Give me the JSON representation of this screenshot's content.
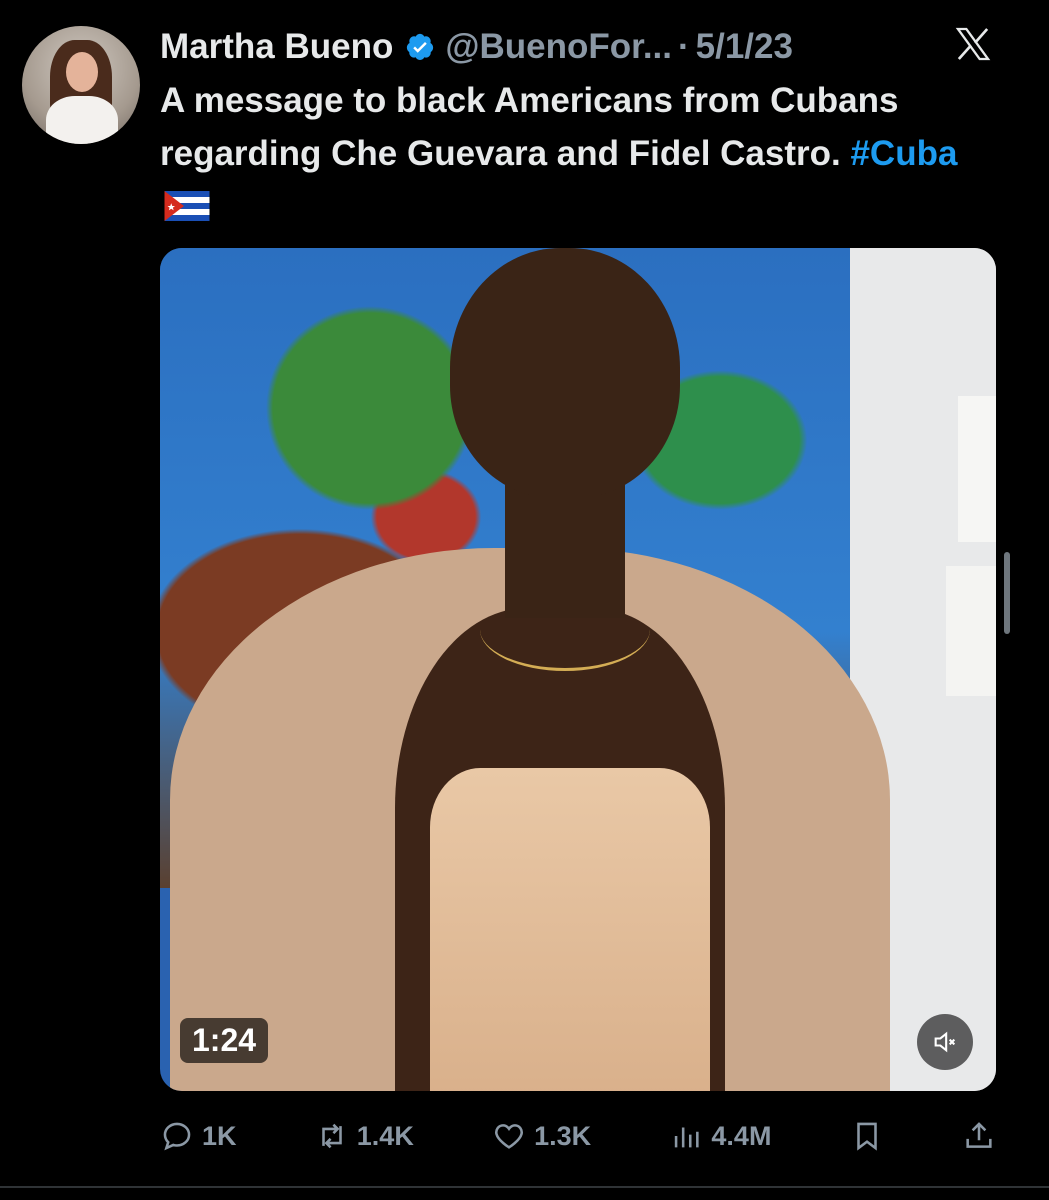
{
  "tweet": {
    "author_name": "Martha Bueno",
    "handle": "@BuenoFor...",
    "separator": "·",
    "date": "5/1/23",
    "text_main": "A message to black Americans from Cubans regarding Che Guevara and Fidel Castro.",
    "hashtag": "#Cuba"
  },
  "media": {
    "duration": "1:24"
  },
  "actions": {
    "replies": "1K",
    "reposts": "1.4K",
    "likes": "1.3K",
    "views": "4.4M"
  },
  "icons": {
    "logo": "x-logo-icon",
    "verified": "verified-badge-icon",
    "flag": "cuba-flag-icon",
    "mute": "mute-icon",
    "reply": "reply-icon",
    "repost": "repost-icon",
    "like": "like-icon",
    "views": "views-icon",
    "bookmark": "bookmark-icon",
    "share": "share-icon"
  },
  "colors": {
    "background": "#000000",
    "text": "#e7e9ea",
    "muted": "#8b98a5",
    "accent": "#1d9bf0"
  }
}
